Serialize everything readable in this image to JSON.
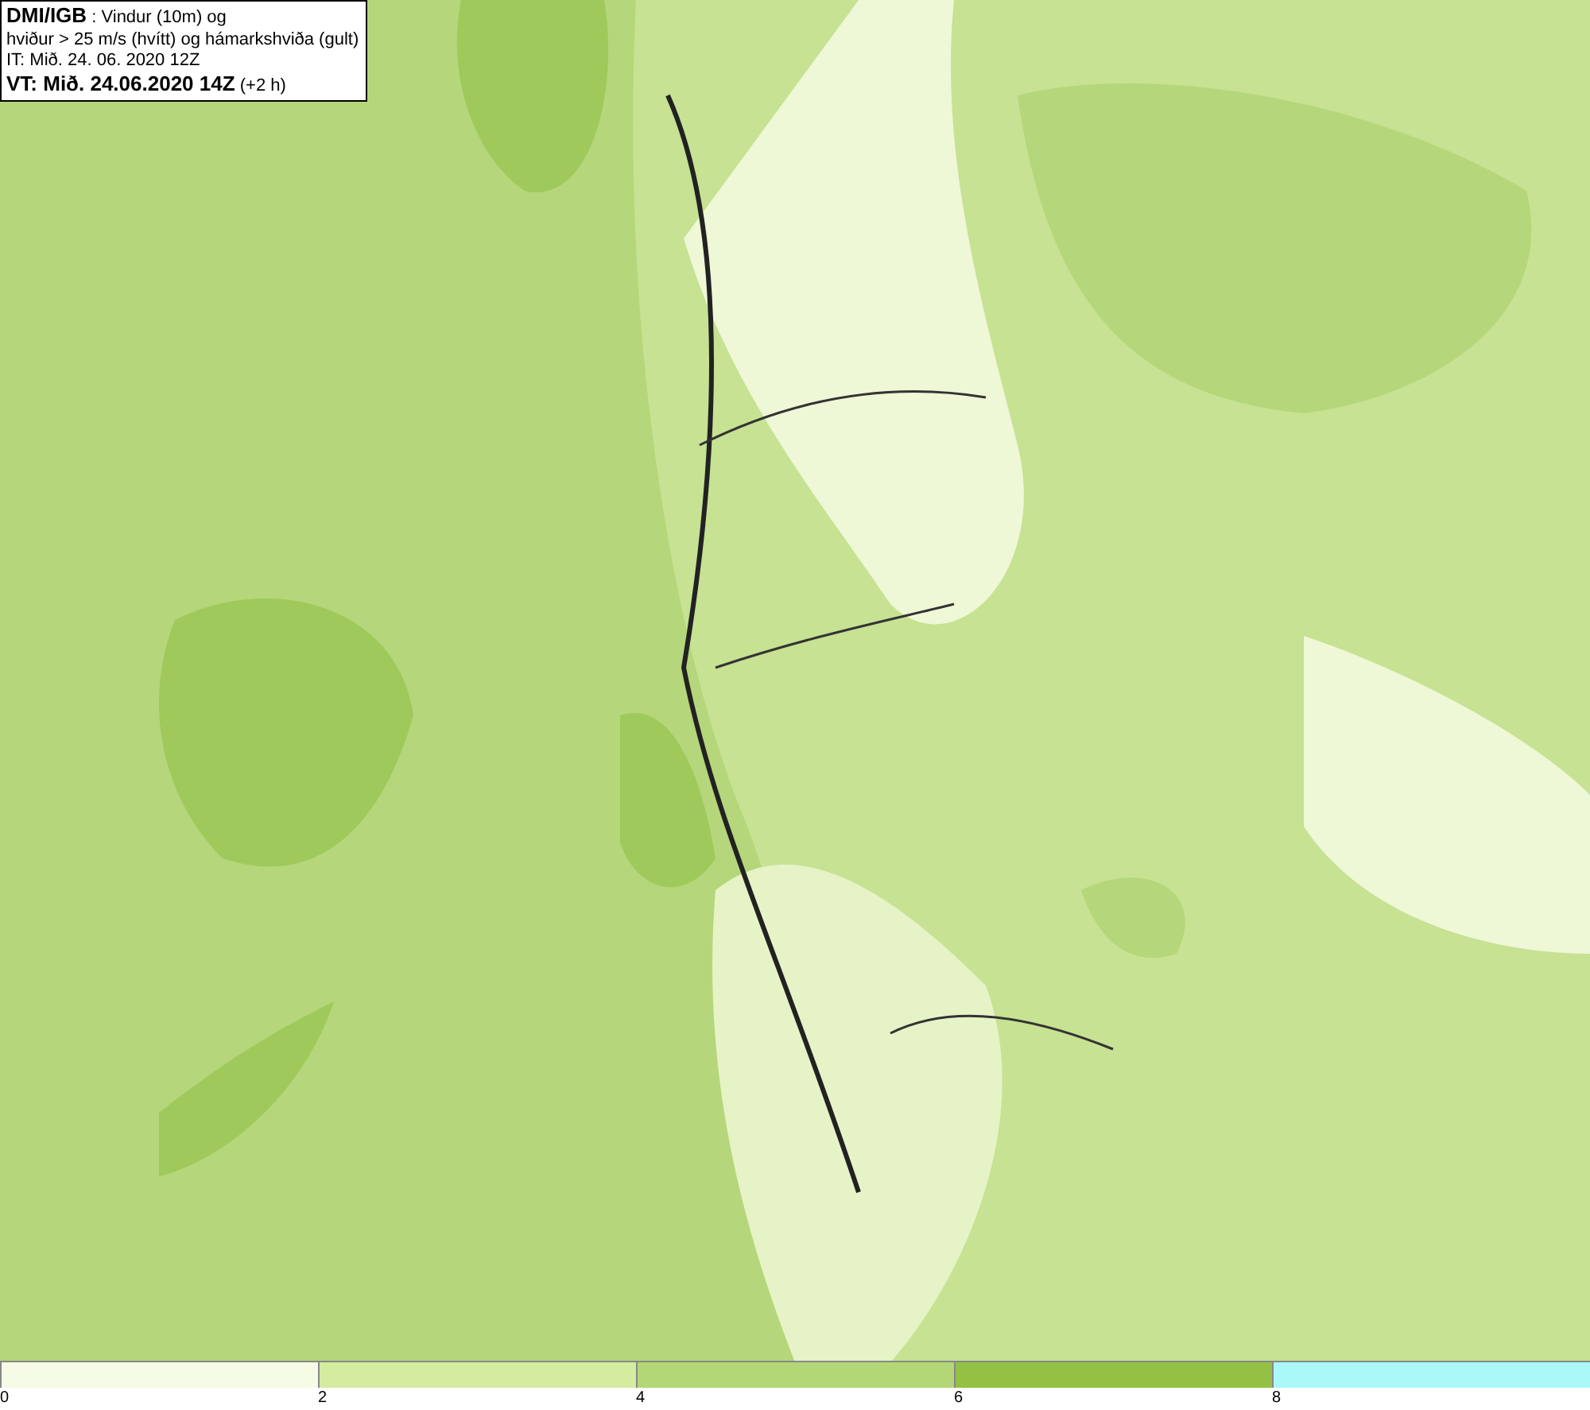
{
  "info_box": {
    "lines": [
      "**DMI/IGB** : Vindur (10m) og",
      "hviður > 25 m/s (hvítt) og hámarkshviða (gult)",
      "IT: Mið. 24. 06. 2020 12Z",
      "**VT: Mið. 24.06.2020 14Z** (+2 h)"
    ]
  },
  "color_scale": {
    "segments": [
      {
        "color": "#f5fbe4"
      },
      {
        "color": "#d5eba0"
      },
      {
        "color": "#b3d676"
      },
      {
        "color": "#94c044"
      },
      {
        "color": "#aaf8f8"
      }
    ],
    "ticks": [
      "0",
      "2",
      "4",
      "6",
      "8"
    ]
  }
}
